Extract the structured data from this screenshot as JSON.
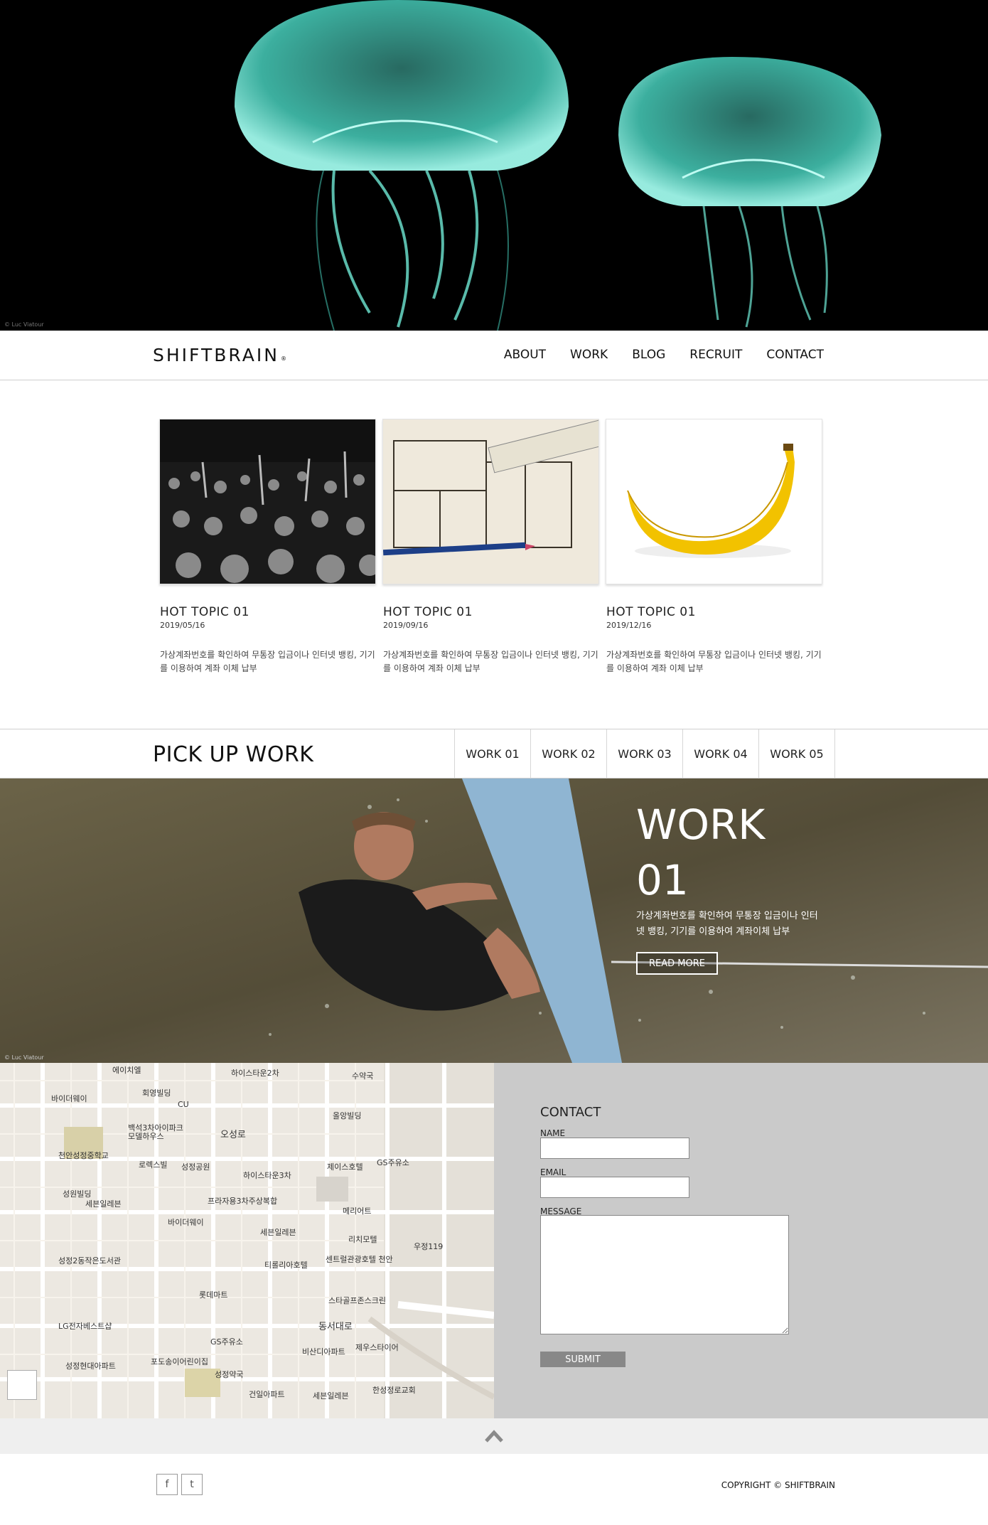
{
  "hero": {
    "credit": "© Luc Viatour"
  },
  "header": {
    "logo": "SHIFTBRAIN",
    "logo_mark": "®",
    "nav": [
      "ABOUT",
      "WORK",
      "BLOG",
      "RECRUIT",
      "CONTACT"
    ]
  },
  "topics": [
    {
      "title": "HOT TOPIC 01",
      "date": "2019/05/16",
      "desc": "가상계좌번호를 확인하여 무통장 입금이나 인터넷 뱅킹, 기기를 이용하여 계좌 이체 납부"
    },
    {
      "title": "HOT TOPIC 01",
      "date": "2019/09/16",
      "desc": "가상계좌번호를 확인하여 무통장 입금이나 인터넷 뱅킹, 기기를 이용하여 계좌 이체 납부"
    },
    {
      "title": "HOT TOPIC 01",
      "date": "2019/12/16",
      "desc": "가상계좌번호를 확인하여 무통장 입금이나 인터넷 뱅킹, 기기를 이용하여 계좌 이체 납부"
    }
  ],
  "pickup": {
    "title": "PICK UP WORK",
    "tabs": [
      "WORK 01",
      "WORK 02",
      "WORK 03",
      "WORK 04",
      "WORK 05"
    ]
  },
  "work": {
    "title": "WORK 01",
    "desc": "가상계좌번호를 확인하여 무통장 입금이나 인터넷 뱅킹, 기기를 이용하여 계좌이체 납부",
    "button": "READ MORE",
    "credit": "© Luc Viatour"
  },
  "map": {
    "labels": [
      "에이치엘",
      "하이스타운2차",
      "수약국",
      "바이더웨이",
      "회영빌딩",
      "CU",
      "올앙빌딩",
      "오성로",
      "백석3차아이파크모델하우스",
      "천안성정중학교",
      "로렉스빌",
      "성정공원",
      "하이스타운3차",
      "제이스호텔",
      "GS주유소",
      "성원빌딩",
      "세븐일레븐",
      "프라자용3차주상복합",
      "메리어트",
      "바이더웨이",
      "세븐일레븐",
      "리치모텔",
      "우정119",
      "성정2동작은도서관",
      "티롤리아호텔",
      "센트럴관광호텔 천안",
      "롯데마트",
      "스타골프존스크린",
      "동서대로",
      "LG전자베스트샵",
      "GS주유소",
      "비산디아파트",
      "제우스타이어",
      "성정현대아파트",
      "포도송이어린이집",
      "성정약국",
      "건일아파트",
      "세븐일레븐",
      "한성정로교회"
    ]
  },
  "contact": {
    "title": "CONTACT",
    "name_label": "NAME",
    "email_label": "EMAIL",
    "message_label": "MESSAGE",
    "submit": "SUBMIT"
  },
  "footer": {
    "facebook": "f",
    "twitter": "t",
    "copyright": "COPYRIGHT © SHIFTBRAIN"
  },
  "colors": {
    "accent_teal": "#6fe8d4",
    "contact_bg": "#cacaca",
    "submit_bg": "#888888"
  }
}
